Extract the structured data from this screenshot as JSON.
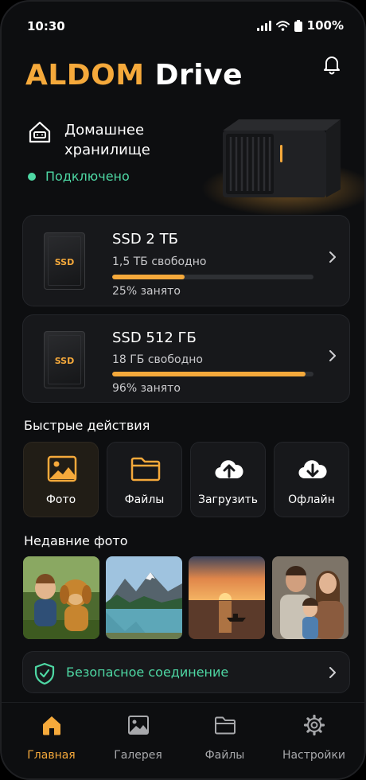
{
  "status_bar": {
    "time": "10:30",
    "battery": "100%"
  },
  "header": {
    "brand": "ALDOM",
    "product": "Drive"
  },
  "storage": {
    "name": "Домашнее хранилище",
    "status": "Подключено"
  },
  "drives": [
    {
      "chip_label": "SSD",
      "name": "SSD 2 ТБ",
      "free": "1,5 ТБ свободно",
      "used_label": "25% занято",
      "used_fraction": 0.36
    },
    {
      "chip_label": "SSD",
      "name": "SSD 512 ГБ",
      "free": "18 ГБ свободно",
      "used_label": "96% занято",
      "used_fraction": 0.96
    }
  ],
  "quick_actions": {
    "title": "Быстрые действия",
    "items": [
      {
        "label": "Фото",
        "icon": "image-icon"
      },
      {
        "label": "Файлы",
        "icon": "folder-icon"
      },
      {
        "label": "Загрузить",
        "icon": "cloud-upload-icon"
      },
      {
        "label": "Офлайн",
        "icon": "cloud-download-icon"
      }
    ]
  },
  "recent_photos": {
    "title": "Недавние фото",
    "items": [
      "child-with-dog-photo",
      "mountain-lake-photo",
      "sunset-boat-photo",
      "family-portrait-photo"
    ]
  },
  "secure_connection": {
    "label": "Безопасное соединение",
    "icon": "shield-check-icon"
  },
  "tabbar": {
    "tabs": [
      {
        "label": "Главная",
        "icon": "home-icon",
        "active": true
      },
      {
        "label": "Галерея",
        "icon": "gallery-icon",
        "active": false
      },
      {
        "label": "Файлы",
        "icon": "folder-icon",
        "active": false
      },
      {
        "label": "Настройки",
        "icon": "gear-icon",
        "active": false
      }
    ]
  },
  "colors": {
    "accent": "#f5a93b",
    "success": "#4ed8a4",
    "background": "#0d0e10",
    "card": "#17181b"
  }
}
